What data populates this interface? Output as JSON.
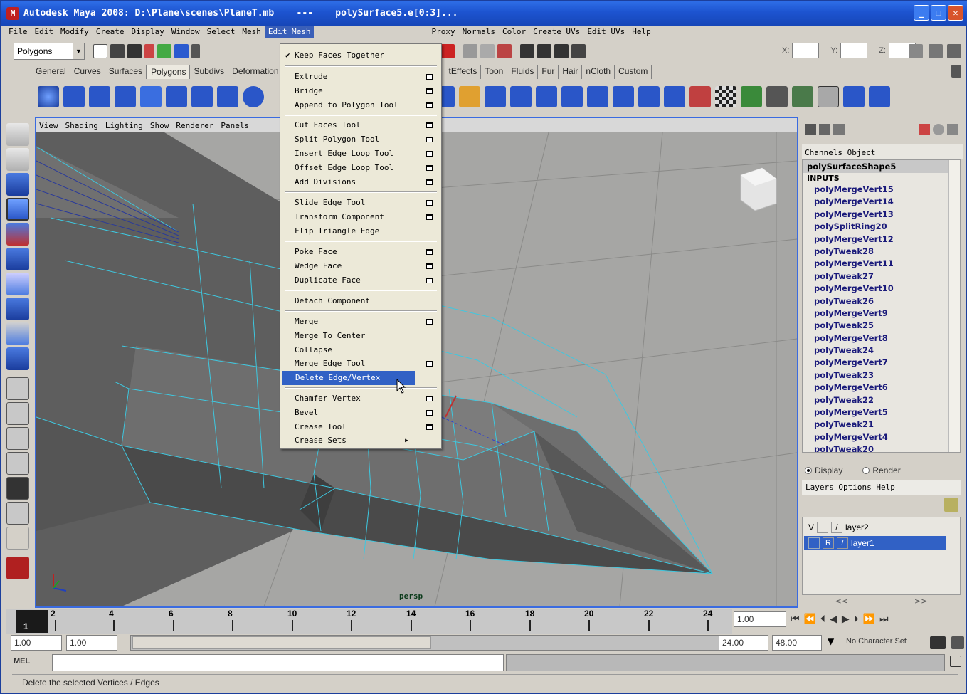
{
  "window": {
    "title": "Autodesk Maya 2008: D:\\Plane\\scenes\\PlaneT.mb    ---    polySurface5.e[0:3]..."
  },
  "menubar": [
    "File",
    "Edit",
    "Modify",
    "Create",
    "Display",
    "Window",
    "Select",
    "Mesh",
    "Edit Mesh",
    "Proxy",
    "Normals",
    "Color",
    "Create UVs",
    "Edit UVs",
    "Help"
  ],
  "mode_selector": {
    "value": "Polygons"
  },
  "coords": {
    "x_label": "X:",
    "y_label": "Y:",
    "z_label": "Z:"
  },
  "shelf_tabs": [
    "General",
    "Curves",
    "Surfaces",
    "Polygons",
    "Subdivs",
    "Deformation",
    "tEffects",
    "Toon",
    "Fluids",
    "Fur",
    "Hair",
    "nCloth",
    "Custom"
  ],
  "viewport": {
    "menu": [
      "View",
      "Shading",
      "Lighting",
      "Show",
      "Renderer",
      "Panels"
    ],
    "camera_label": "persp"
  },
  "edit_mesh_menu": {
    "keep_faces_together": "Keep Faces Together",
    "items": [
      {
        "label": "Extrude"
      },
      {
        "label": "Bridge"
      },
      {
        "label": "Append to Polygon Tool"
      },
      {
        "label": "Cut Faces Tool"
      },
      {
        "label": "Split Polygon Tool"
      },
      {
        "label": "Insert Edge Loop Tool"
      },
      {
        "label": "Offset Edge Loop Tool"
      },
      {
        "label": "Add Divisions"
      },
      {
        "label": "Slide Edge Tool"
      },
      {
        "label": "Transform Component"
      },
      {
        "label": "Flip Triangle Edge"
      },
      {
        "label": "Poke Face"
      },
      {
        "label": "Wedge Face"
      },
      {
        "label": "Duplicate Face"
      },
      {
        "label": "Detach Component"
      },
      {
        "label": "Merge"
      },
      {
        "label": "Merge To Center"
      },
      {
        "label": "Collapse"
      },
      {
        "label": "Merge Edge Tool"
      },
      {
        "label": "Delete Edge/Vertex"
      },
      {
        "label": "Chamfer Vertex"
      },
      {
        "label": "Bevel"
      },
      {
        "label": "Crease Tool"
      },
      {
        "label": "Crease Sets"
      }
    ]
  },
  "channel_box": {
    "tabs": "Channels Object",
    "shape": "polySurfaceShape5",
    "inputs_label": "INPUTS",
    "nodes": [
      "polyMergeVert15",
      "polyMergeVert14",
      "polyMergeVert13",
      "polySplitRing20",
      "polyMergeVert12",
      "polyTweak28",
      "polyMergeVert11",
      "polyTweak27",
      "polyMergeVert10",
      "polyTweak26",
      "polyMergeVert9",
      "polyTweak25",
      "polyMergeVert8",
      "polyTweak24",
      "polyMergeVert7",
      "polyTweak23",
      "polyMergeVert6",
      "polyTweak22",
      "polyMergeVert5",
      "polyTweak21",
      "polyMergeVert4",
      "polyTweak20"
    ]
  },
  "layer_editor": {
    "display_label": "Display",
    "render_label": "Render",
    "menu": "Layers Options Help",
    "layers": [
      {
        "vis": "V",
        "flag": "",
        "name": "layer2"
      },
      {
        "vis": "",
        "flag": "R",
        "name": "layer1"
      }
    ],
    "scroll_left": "<<",
    "scroll_right": ">>"
  },
  "timeline": {
    "current_frame": "1",
    "ticks": [
      "2",
      "4",
      "6",
      "8",
      "10",
      "12",
      "14",
      "16",
      "18",
      "20",
      "22",
      "24"
    ],
    "current_time_field": "1.00"
  },
  "range": {
    "start": "1.00",
    "playback_start": "1.00",
    "playback_end": "24.00",
    "end": "48.00",
    "character_set": "No Character Set"
  },
  "mel": {
    "label": "MEL"
  },
  "help_line": "Delete the selected Vertices / Edges",
  "colors": {
    "title_blue": "#1d54d0",
    "menu_highlight": "#3161c5",
    "wire_cyan": "#3ec8e0"
  }
}
